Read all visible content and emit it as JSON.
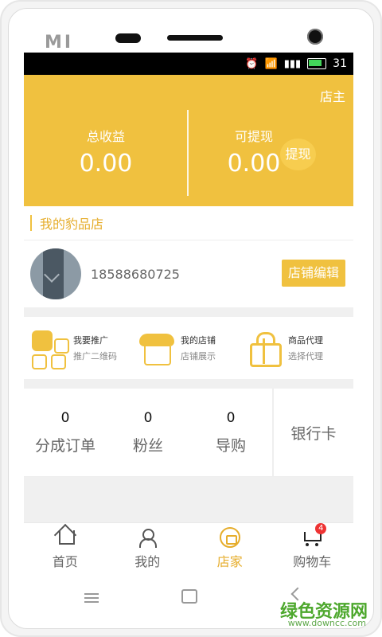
{
  "device": {
    "brand": "MI",
    "status_time": "31"
  },
  "hero": {
    "owner_label": "店主",
    "total_income_label": "总收益",
    "total_income_value": "0.00",
    "withdrawable_label": "可提现",
    "withdrawable_value": "0.00",
    "withdraw_button": "提现"
  },
  "shop": {
    "title": "我的豹品店",
    "phone": "18588680725",
    "edit_button": "店铺编辑"
  },
  "features": [
    {
      "title": "我要推广",
      "sub": "推广二维码"
    },
    {
      "title": "我的店铺",
      "sub": "店铺展示"
    },
    {
      "title": "商品代理",
      "sub": "选择代理"
    }
  ],
  "stats": [
    {
      "value": "0",
      "label": "分成订单"
    },
    {
      "value": "0",
      "label": "粉丝"
    },
    {
      "value": "0",
      "label": "导购"
    }
  ],
  "bank_label": "银行卡",
  "tabs": [
    {
      "label": "首页",
      "icon": "home-icon"
    },
    {
      "label": "我的",
      "icon": "user-icon"
    },
    {
      "label": "店家",
      "icon": "store-icon",
      "active": true
    },
    {
      "label": "购物车",
      "icon": "cart-icon",
      "badge": "4"
    }
  ],
  "watermark": {
    "main": "绿色资源网",
    "sub": "www.downcc.com"
  }
}
